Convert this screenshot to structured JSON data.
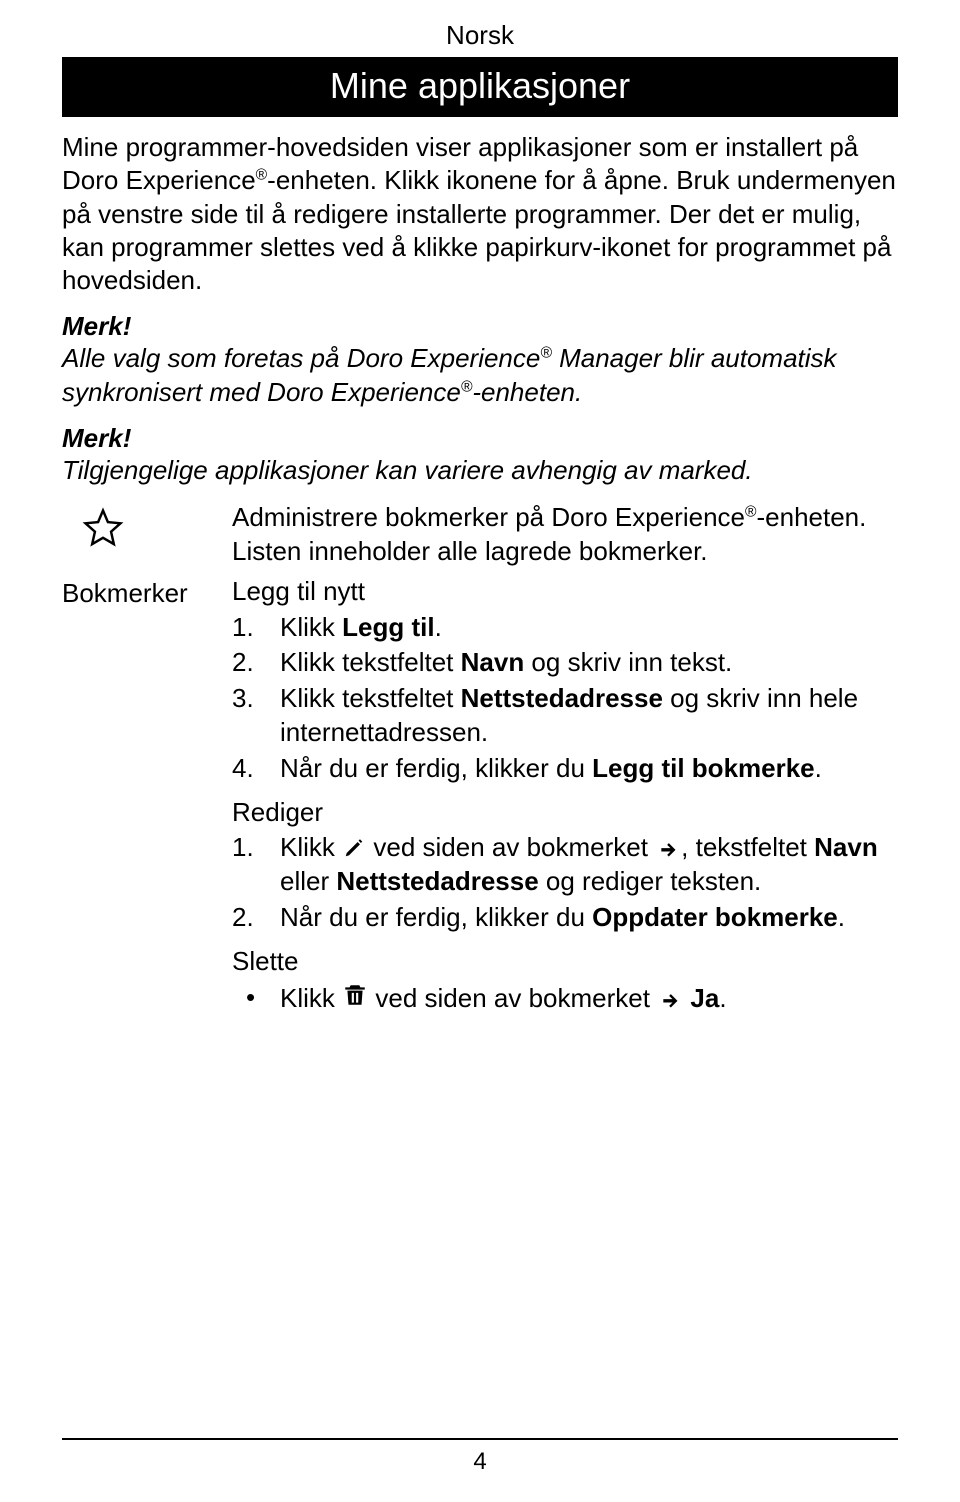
{
  "language_label": "Norsk",
  "banner_title": "Mine applikasjoner",
  "intro": {
    "part1": "Mine programmer-hovedsiden viser applikasjoner som er installert på Doro Experience",
    "reg1": "®",
    "part2": "-enheten. Klikk ikonene for å åpne. Bruk undermenyen på venstre side til å redigere installerte programmer. Der det er mulig, kan programmer slettes ved å klikke papirkurv-ikonet for programmet på hovedsiden."
  },
  "merk_label": "Merk!",
  "note1": {
    "part1": "Alle valg som foretas på Doro Experience",
    "reg1": "®",
    "part2": " Manager blir automatisk synkronisert med Doro Experience",
    "reg2": "®",
    "part3": "-enheten."
  },
  "note2": "Tilgjengelige applikasjoner kan variere avhengig av marked.",
  "bookmarks": {
    "left_label": "Bokmerker",
    "desc_part1": "Administrere bokmerker på Doro Experience",
    "desc_reg": "®",
    "desc_part2": "-enheten. Listen inneholder alle lagrede bokmerker.",
    "leggtil_header": "Legg til nytt",
    "leggtil_items": [
      {
        "num": "1.",
        "pre": "Klikk ",
        "bold": "Legg til",
        "post": "."
      },
      {
        "num": "2.",
        "pre": "Klikk tekstfeltet ",
        "bold": "Navn",
        "post": " og skriv inn tekst."
      },
      {
        "num": "3.",
        "pre": "Klikk tekstfeltet ",
        "bold": "Nettstedadresse",
        "post": " og skriv inn hele internettadressen."
      },
      {
        "num": "4.",
        "pre": "Når du er ferdig, klikker du ",
        "bold": "Legg til bokmerke",
        "post": "."
      }
    ],
    "rediger_header": "Rediger",
    "rediger_items": [
      {
        "num": "1.",
        "pre": "Klikk ",
        "icon": "pencil",
        "mid1": " ved siden av bokmerket ",
        "icon2": "arrow-right",
        "mid2": ", tekstfeltet ",
        "bold1": "Navn",
        "mid3": " eller ",
        "bold2": "Nettstedadresse",
        "post": " og rediger teksten."
      },
      {
        "num": "2.",
        "pre": "Når du er ferdig, klikker du ",
        "bold": "Oppdater bokmerke",
        "post": "."
      }
    ],
    "slette_header": "Slette",
    "slette_item": {
      "pre": "Klikk ",
      "icon": "trash",
      "mid": " ved siden av bokmerket ",
      "icon2": "arrow-right",
      "mid2": " ",
      "bold": "Ja",
      "post": "."
    }
  },
  "page_number": "4"
}
